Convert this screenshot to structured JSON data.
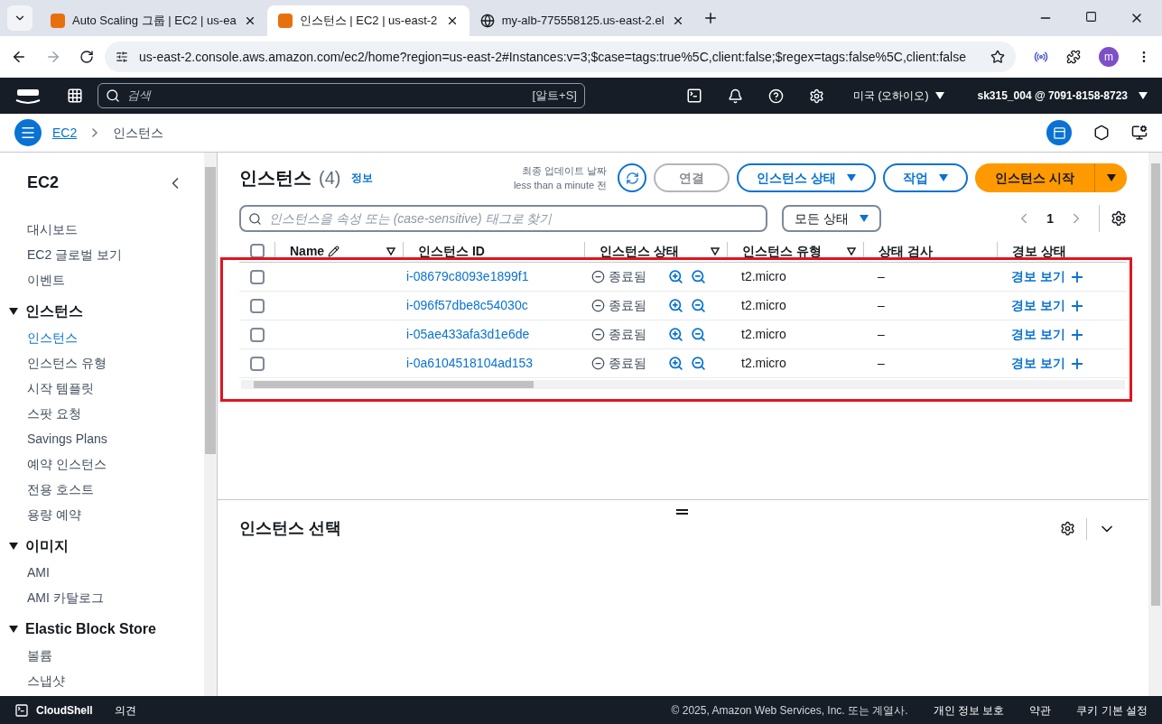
{
  "browser": {
    "tabs": [
      {
        "title": "Auto Scaling 그룹 | EC2 | us-ea",
        "selected": false,
        "kind": "aws"
      },
      {
        "title": "인스턴스 | EC2 | us-east-2",
        "selected": true,
        "kind": "aws"
      },
      {
        "title": "my-alb-775558125.us-east-2.el",
        "selected": false,
        "kind": "globe"
      }
    ],
    "address": "us-east-2.console.aws.amazon.com/ec2/home?region=us-east-2#Instances:v=3;$case=tags:true%5C,client:false;$regex=tags:false%5C,client:false",
    "avatar": "m"
  },
  "aws_nav": {
    "search_placeholder": "검색",
    "shortcut": "[알트+S]",
    "region": "미국 (오하이오)",
    "account": "sk315_004 @ 7091-8158-8723"
  },
  "breadcrumb": {
    "link": "EC2",
    "current": "인스턴스"
  },
  "sidebar": {
    "title": "EC2",
    "items": [
      {
        "kind": "link",
        "label": "대시보드",
        "selected": false
      },
      {
        "kind": "link",
        "label": "EC2 글로벌 보기",
        "selected": false
      },
      {
        "kind": "link",
        "label": "이벤트",
        "selected": false
      },
      {
        "kind": "section",
        "label": "인스턴스",
        "expanded": true,
        "children": [
          {
            "label": "인스턴스",
            "selected": true
          },
          {
            "label": "인스턴스 유형",
            "selected": false
          },
          {
            "label": "시작 템플릿",
            "selected": false
          },
          {
            "label": "스팟 요청",
            "selected": false
          },
          {
            "label": "Savings Plans",
            "selected": false
          },
          {
            "label": "예약 인스턴스",
            "selected": false
          },
          {
            "label": "전용 호스트",
            "selected": false
          },
          {
            "label": "용량 예약",
            "selected": false
          }
        ]
      },
      {
        "kind": "section",
        "label": "이미지",
        "expanded": true,
        "children": [
          {
            "label": "AMI",
            "selected": false
          },
          {
            "label": "AMI 카탈로그",
            "selected": false
          }
        ]
      },
      {
        "kind": "section",
        "label": "Elastic Block Store",
        "expanded": true,
        "children": [
          {
            "label": "볼륨",
            "selected": false
          },
          {
            "label": "스냅샷",
            "selected": false
          }
        ]
      }
    ]
  },
  "instances": {
    "title": "인스턴스",
    "count": "(4)",
    "info": "정보",
    "last_updated_label": "최종 업데이트 날짜",
    "last_updated": "less than a minute 전",
    "buttons": [
      {
        "label": "연결",
        "kind": "plain",
        "disabled": true
      },
      {
        "label": "인스턴스 상태",
        "kind": "dropdown",
        "disabled": false
      },
      {
        "label": "작업",
        "kind": "dropdown",
        "disabled": false
      },
      {
        "label": "인스턴스 시작",
        "kind": "primary",
        "disabled": false
      }
    ],
    "search_placeholder": "인스턴스을 속성 또는 (case-sensitive) 태그로 찾기",
    "state_filter": "모든 상태",
    "page": "1",
    "select_all_checked": false,
    "columns": [
      {
        "label": "Name",
        "kind": "edit"
      },
      {
        "label": "인스턴스 ID",
        "kind": "plain"
      },
      {
        "label": "인스턴스 상태",
        "kind": "filter"
      },
      {
        "label": "인스턴스 유형",
        "kind": "filter"
      },
      {
        "label": "상태 검사",
        "kind": "plain"
      },
      {
        "label": "경보 상태",
        "kind": "plain"
      }
    ],
    "rows": [
      {
        "id": "i-08679c8093e1899f1",
        "state": "종료됨",
        "type": "t2.micro",
        "check": "–",
        "alarm": "경보 보기",
        "checked": false
      },
      {
        "id": "i-096f57dbe8c54030c",
        "state": "종료됨",
        "type": "t2.micro",
        "check": "–",
        "alarm": "경보 보기",
        "checked": false
      },
      {
        "id": "i-05ae433afa3d1e6de",
        "state": "종료됨",
        "type": "t2.micro",
        "check": "–",
        "alarm": "경보 보기",
        "checked": false
      },
      {
        "id": "i-0a6104518104ad153",
        "state": "종료됨",
        "type": "t2.micro",
        "check": "–",
        "alarm": "경보 보기",
        "checked": false
      }
    ]
  },
  "detail": {
    "title": "인스턴스 선택"
  },
  "footer": {
    "cloudshell": "CloudShell",
    "feedback": "의견",
    "copyright": "© 2025, Amazon Web Services, Inc. 또는 계열사.",
    "links": [
      "개인 정보 보호",
      "약관",
      "쿠키 기본 설정"
    ]
  }
}
